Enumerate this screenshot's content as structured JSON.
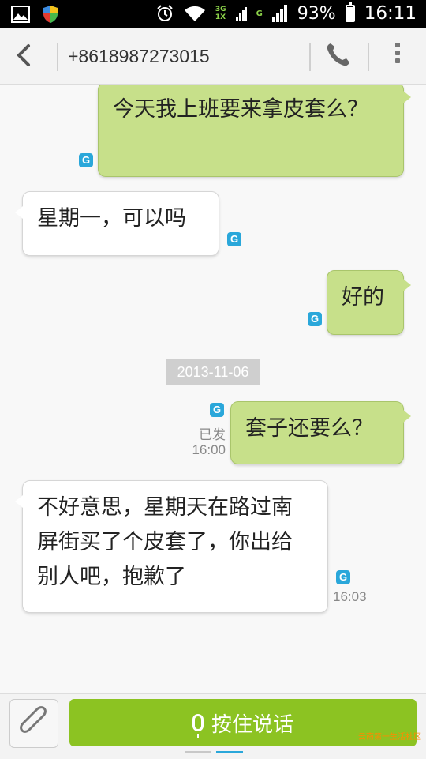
{
  "status_bar": {
    "network_top": "3G",
    "network_bottom": "1X",
    "network_g": "G",
    "battery": "93%",
    "battery_level": 0.93,
    "time": "16:11"
  },
  "header": {
    "title": "+8618987273015"
  },
  "messages": [
    {
      "direction": "out",
      "text": "今天我上班要来拿皮套么？"
    },
    {
      "direction": "in",
      "text": "星期一，可以吗"
    },
    {
      "direction": "out",
      "text": "好的"
    },
    {
      "direction": "out",
      "text": "套子还要么？",
      "status": "已发",
      "time": "16:00"
    },
    {
      "direction": "in",
      "text": "不好意思，星期天在路过南屏街买了个皮套了，你出给别人吧，抱歉了",
      "time": "16:03"
    }
  ],
  "date_separator": "2013-11-06",
  "g_label": "G",
  "bottom_bar": {
    "voice_label": "按住说话"
  },
  "watermark": "云南第一生活社区",
  "colors": {
    "outgoing_bubble": "#c7e08a",
    "incoming_bubble": "#ffffff",
    "voice_button": "#8cc322",
    "sim_badge": "#2aa7da"
  }
}
